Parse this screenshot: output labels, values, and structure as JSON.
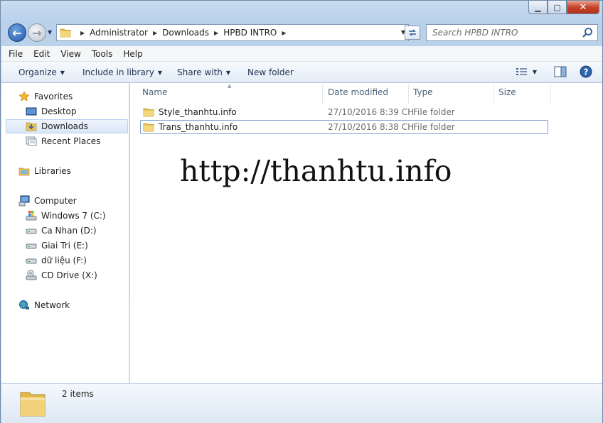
{
  "window": {
    "min_glyph": "▁",
    "max_glyph": "▢",
    "close_glyph": "✕"
  },
  "nav": {
    "back_glyph": "←",
    "forward_glyph": "→",
    "history_glyph": "▼",
    "breadcrumbs": [
      "Administrator",
      "Downloads",
      "HPBD INTRO"
    ],
    "search_placeholder": "Search HPBD INTRO"
  },
  "menu": [
    "File",
    "Edit",
    "View",
    "Tools",
    "Help"
  ],
  "commands": {
    "organize": "Organize",
    "include": "Include in library",
    "share": "Share with",
    "new_folder": "New folder"
  },
  "sidebar": {
    "favorites": "Favorites",
    "desktop": "Desktop",
    "downloads": "Downloads",
    "recent": "Recent Places",
    "libraries": "Libraries",
    "computer": "Computer",
    "drives": [
      "Windows 7 (C:)",
      "Ca Nhan (D:)",
      "Giai Tri (E:)",
      "dữ liệu (F:)",
      "CD Drive (X:)"
    ],
    "network": "Network"
  },
  "columns": {
    "name": "Name",
    "date": "Date modified",
    "type": "Type",
    "size": "Size"
  },
  "files": [
    {
      "name": "Style_thanhtu.info",
      "date": "27/10/2016 8:39 CH",
      "type": "File folder",
      "size": ""
    },
    {
      "name": "Trans_thanhtu.info",
      "date": "27/10/2016 8:38 CH",
      "type": "File folder",
      "size": ""
    }
  ],
  "watermark": "http://thanhtu.info",
  "details": {
    "count": "2 items"
  },
  "colors": {
    "accent": "#1d57a8",
    "folder": "#e8c35a",
    "selection": "#d9e7f8"
  }
}
